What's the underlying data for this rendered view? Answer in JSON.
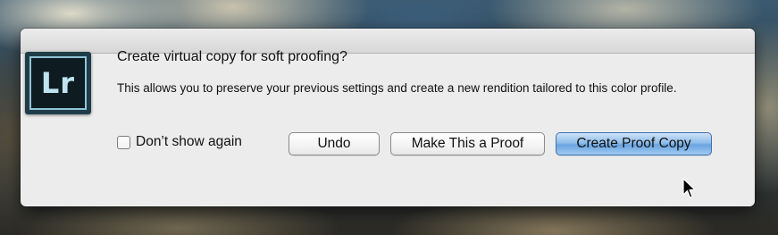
{
  "dialog": {
    "app_icon_text": "Lr",
    "heading": "Create virtual copy for soft proofing?",
    "message": "This allows you to preserve your previous settings and create a new rendition tailored to this color profile.",
    "checkbox_label": "Don’t show again",
    "checkbox_checked": false,
    "buttons": {
      "undo": "Undo",
      "make_proof": "Make This a Proof",
      "create_proof_copy": "Create Proof Copy"
    },
    "default_button_color": "#69a4e0"
  },
  "cursor": {
    "icon": "arrow-cursor-icon"
  }
}
